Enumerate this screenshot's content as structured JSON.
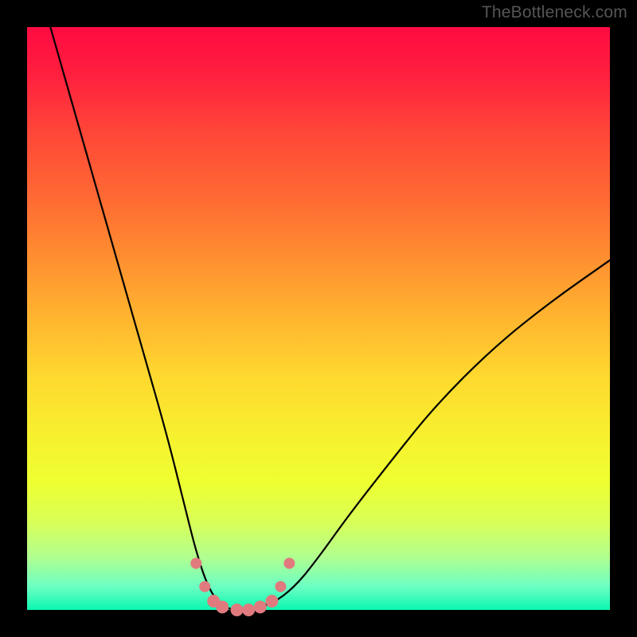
{
  "watermark": "TheBottleneck.com",
  "chart_data": {
    "type": "line",
    "title": "",
    "xlabel": "",
    "ylabel": "",
    "xlim": [
      0,
      100
    ],
    "ylim": [
      0,
      100
    ],
    "grid": false,
    "legend": false,
    "background_gradient": {
      "top_color": "#ff0b42",
      "mid_color": "#ffd92f",
      "bottom_color": "#0bf7b0"
    },
    "series": [
      {
        "name": "bottleneck-curve",
        "color": "#000000",
        "x": [
          4,
          8,
          12,
          16,
          20,
          24,
          27,
          29,
          31,
          33,
          35,
          38,
          42,
          46,
          50,
          55,
          62,
          70,
          80,
          90,
          100
        ],
        "values": [
          100,
          86,
          72,
          58,
          44,
          30,
          18,
          10,
          4,
          1,
          0,
          0,
          1,
          4,
          9,
          16,
          25,
          35,
          45,
          53,
          60
        ]
      }
    ],
    "highlight_points": {
      "color": "#e07a7e",
      "x": [
        29,
        30.5,
        32,
        33.5,
        36,
        38,
        40,
        42,
        43.5,
        45
      ],
      "values": [
        8,
        4,
        1.5,
        0.5,
        0,
        0,
        0.5,
        1.5,
        4,
        8
      ]
    },
    "annotations": []
  }
}
